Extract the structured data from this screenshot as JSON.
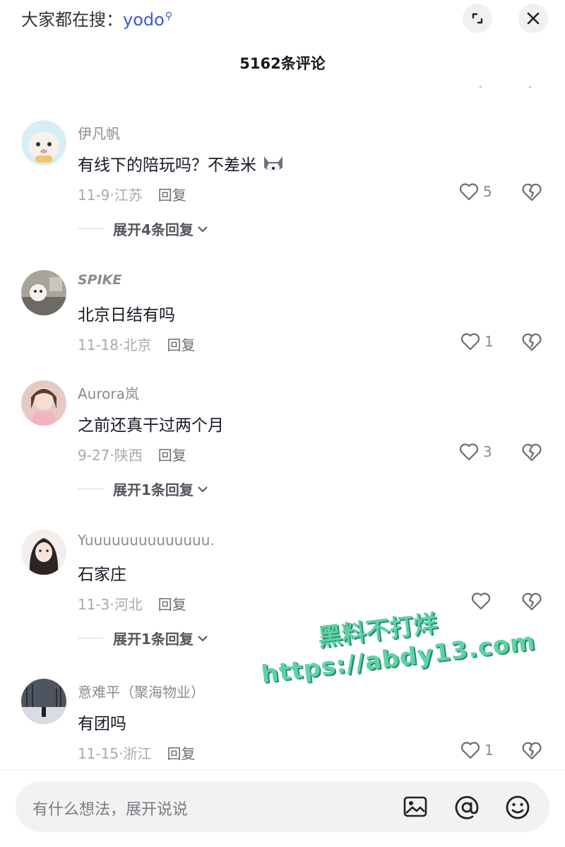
{
  "header": {
    "search_prefix": "大家都在搜：",
    "search_keyword": "yodo",
    "title": "5162条评论"
  },
  "comments": [
    {
      "username": "伊凡帆",
      "text": "有线下的陪玩吗？不差米",
      "date": "11-9",
      "location": "江苏",
      "reply_label": "回复",
      "likes": "5",
      "expand": "展开4条回复"
    },
    {
      "username": "SPIKE",
      "text": "北京日结有吗",
      "date": "11-18",
      "location": "北京",
      "reply_label": "回复",
      "likes": "1"
    },
    {
      "username": "Aurora岚",
      "text": "之前还真干过两个月",
      "date": "9-27",
      "location": "陕西",
      "reply_label": "回复",
      "likes": "3",
      "expand": "展开1条回复"
    },
    {
      "username": "Yuuuuuuuuuuuuuu.",
      "text": "石家庄",
      "date": "11-3",
      "location": "河北",
      "reply_label": "回复",
      "likes": "",
      "expand": "展开1条回复"
    },
    {
      "username": "意难平（聚海物业）",
      "text": "有团吗",
      "date": "11-15",
      "location": "浙江",
      "reply_label": "回复",
      "likes": "1"
    }
  ],
  "composer": {
    "placeholder": "有什么想法，展开说说"
  },
  "watermark": {
    "line1": "黑料不打烊",
    "line2": "https://abdy13.com"
  },
  "icons": {
    "expand": "expand-icon",
    "close": "close-icon",
    "like": "heart-icon",
    "dislike": "broken-heart-icon",
    "image": "image-icon",
    "mention": "at-icon",
    "emoji": "emoji-icon"
  },
  "colors": {
    "keyword": "#3a5bd8",
    "watermark": "#5fd3a6"
  }
}
